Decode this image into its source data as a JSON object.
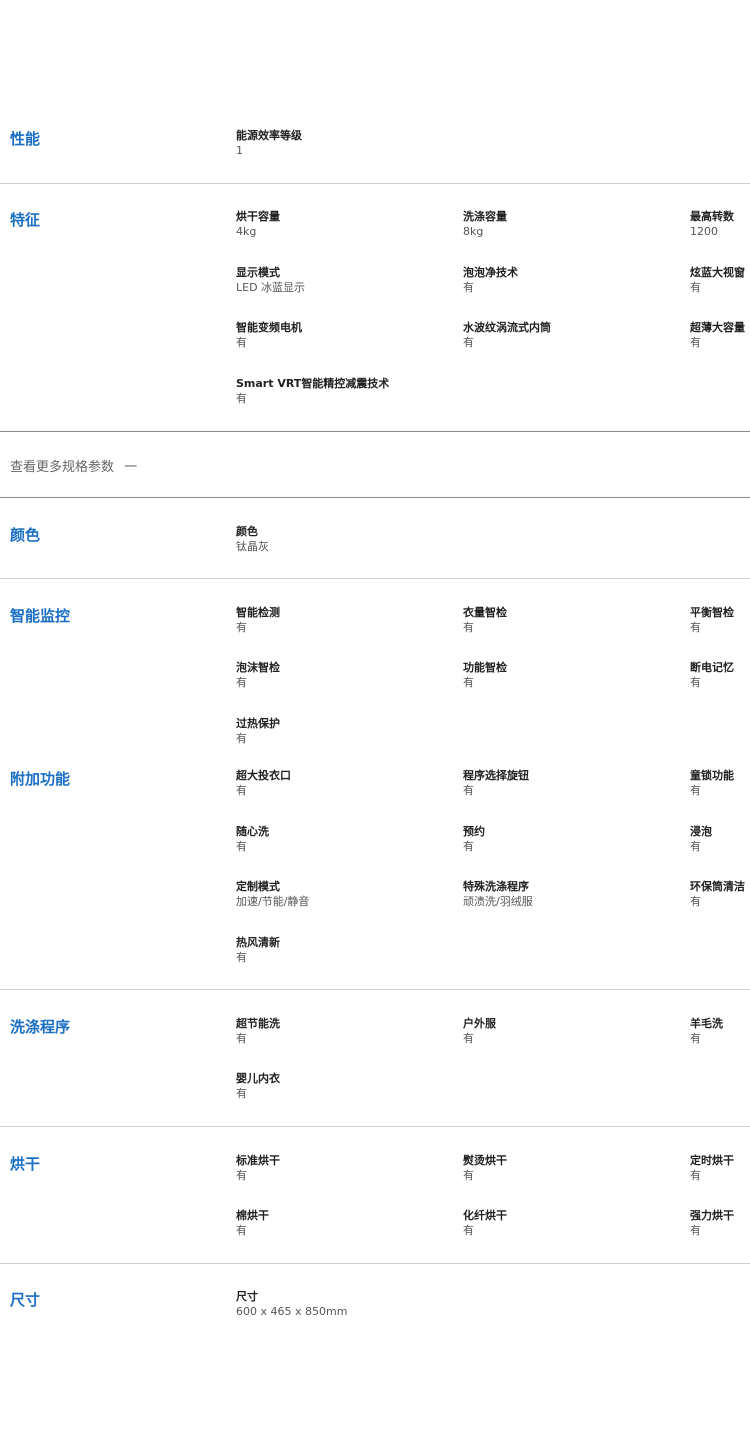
{
  "performance": {
    "title": "性能",
    "items": [
      {
        "label": "能源效率等级",
        "value": "1"
      }
    ]
  },
  "features": {
    "title": "特征",
    "items": [
      {
        "label": "烘干容量",
        "value": "4kg"
      },
      {
        "label": "洗涤容量",
        "value": "8kg"
      },
      {
        "label": "最高转数",
        "value": "1200"
      },
      {
        "label": "显示模式",
        "value": "LED 冰蓝显示"
      },
      {
        "label": "泡泡净技术",
        "value": "有"
      },
      {
        "label": "炫蓝大视窗",
        "value": "有"
      },
      {
        "label": "智能变频电机",
        "value": "有"
      },
      {
        "label": "水波纹涡流式内筒",
        "value": "有"
      },
      {
        "label": "超薄大容量",
        "value": "有"
      },
      {
        "label": "Smart VRT智能精控减震技术",
        "value": "有"
      }
    ]
  },
  "more_specs": {
    "label": "查看更多规格参数",
    "toggle": "一"
  },
  "color": {
    "title": "颜色",
    "items": [
      {
        "label": "颜色",
        "value": "钛晶灰"
      }
    ]
  },
  "smart_monitor": {
    "title": "智能监控",
    "items": [
      {
        "label": "智能检测",
        "value": "有"
      },
      {
        "label": "衣量智检",
        "value": "有"
      },
      {
        "label": "平衡智检",
        "value": "有"
      },
      {
        "label": "泡沫智检",
        "value": "有"
      },
      {
        "label": "功能智检",
        "value": "有"
      },
      {
        "label": "断电记忆",
        "value": "有"
      },
      {
        "label": "过热保护",
        "value": "有"
      }
    ]
  },
  "extra_functions": {
    "title": "附加功能",
    "items": [
      {
        "label": "超大投衣口",
        "value": "有"
      },
      {
        "label": "程序选择旋钮",
        "value": "有"
      },
      {
        "label": "童锁功能",
        "value": "有"
      },
      {
        "label": "随心洗",
        "value": "有"
      },
      {
        "label": "预约",
        "value": "有"
      },
      {
        "label": "浸泡",
        "value": "有"
      },
      {
        "label": "定制模式",
        "value": "加速/节能/静音"
      },
      {
        "label": "特殊洗涤程序",
        "value": "顽渍洗/羽绒服"
      },
      {
        "label": "环保筒清洁",
        "value": "有"
      },
      {
        "label": "热风清新",
        "value": "有"
      }
    ]
  },
  "wash_programs": {
    "title": "洗涤程序",
    "items": [
      {
        "label": "超节能洗",
        "value": "有"
      },
      {
        "label": "户外服",
        "value": "有"
      },
      {
        "label": "羊毛洗",
        "value": "有"
      },
      {
        "label": "婴儿内衣",
        "value": "有"
      }
    ]
  },
  "drying": {
    "title": "烘干",
    "items": [
      {
        "label": "标准烘干",
        "value": "有"
      },
      {
        "label": "熨烫烘干",
        "value": "有"
      },
      {
        "label": "定时烘干",
        "value": "有"
      },
      {
        "label": "棉烘干",
        "value": "有"
      },
      {
        "label": "化纤烘干",
        "value": "有"
      },
      {
        "label": "强力烘干",
        "value": "有"
      }
    ]
  },
  "dimensions": {
    "title": "尺寸",
    "items": [
      {
        "label": "尺寸",
        "value": "600 x 465 x 850mm"
      }
    ]
  }
}
